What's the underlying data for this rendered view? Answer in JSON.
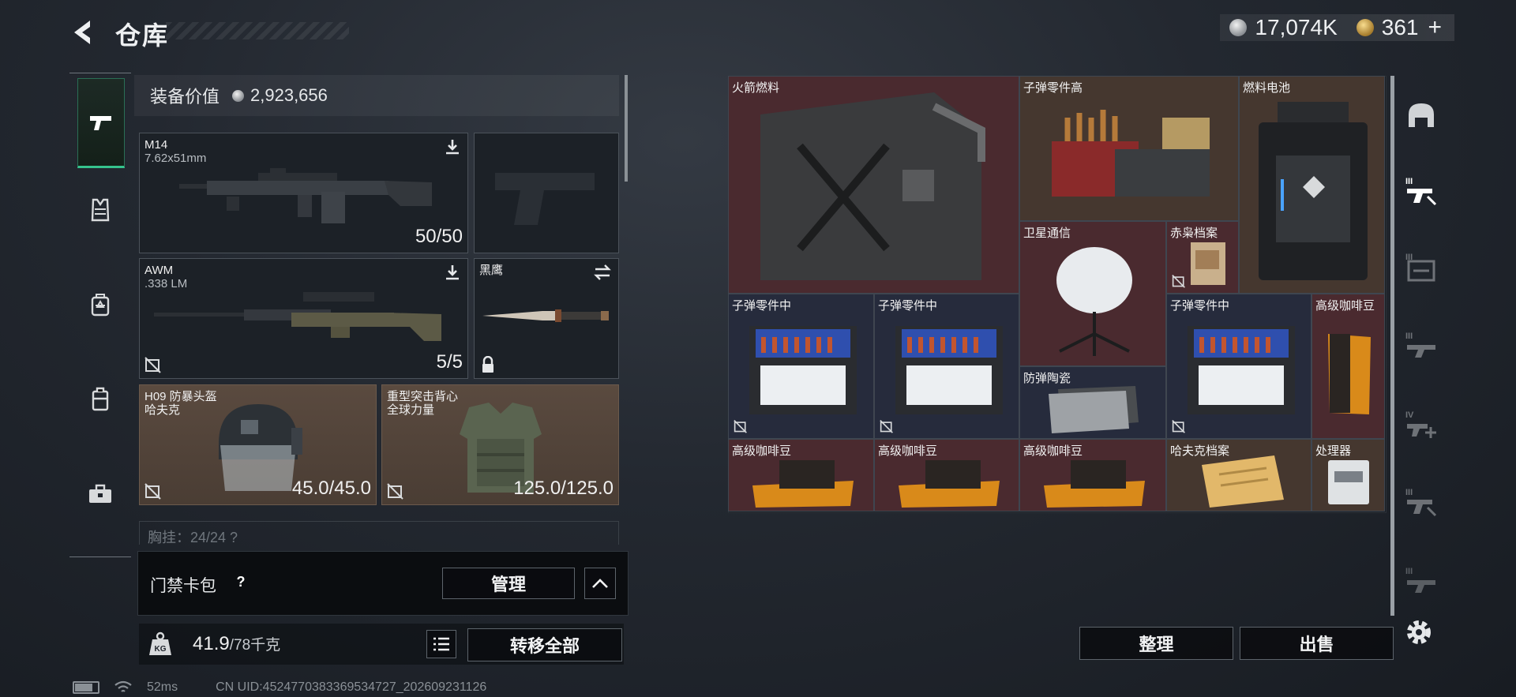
{
  "header": {
    "title": "仓库",
    "silver_amount": "17,074K",
    "gold_amount": "361",
    "gold_add": "+"
  },
  "tabs": [
    {
      "icon": "pistol-icon",
      "active": true
    },
    {
      "icon": "armor-vest-icon",
      "active": false
    },
    {
      "icon": "backpack-icon",
      "active": false
    },
    {
      "icon": "case-icon",
      "active": false
    },
    {
      "icon": "toolbox-icon",
      "active": false
    }
  ],
  "loadout": {
    "value_label": "装备价值",
    "value": "2,923,656",
    "slots": {
      "primary": {
        "name": "M14",
        "caliber": "7.62x51mm",
        "ammo": "50/50"
      },
      "sidearm": {
        "name": ""
      },
      "secondary": {
        "name": "AWM",
        "caliber": ".338 LM",
        "ammo": "5/5"
      },
      "melee": {
        "name": "黑鹰"
      },
      "helmet": {
        "name": "H09 防暴头盔\n哈夫克",
        "durability": "45.0/45.0"
      },
      "vest": {
        "name": "重型突击背心\n全球力量",
        "durability": "125.0/125.0"
      }
    },
    "peek_text": "胸挂：24/24  ?"
  },
  "card_pack": {
    "label": "门禁卡包",
    "help": "?",
    "manage_button": "管理",
    "expand_icon": "chevron-up-icon"
  },
  "weight": {
    "current": "41.9",
    "max": "/78千克",
    "transfer_all": "转移全部"
  },
  "stash": {
    "items": [
      {
        "name": "火箭燃料",
        "color": "red"
      },
      {
        "name": "子弹零件高",
        "color": "brown"
      },
      {
        "name": "燃料电池",
        "color": "brown"
      },
      {
        "name": "卫星通信",
        "color": "red"
      },
      {
        "name": "赤枭档案",
        "color": "red"
      },
      {
        "name": "子弹零件中",
        "color": "blue"
      },
      {
        "name": "子弹零件中",
        "color": "blue"
      },
      {
        "name": "防弹陶瓷",
        "color": "blue"
      },
      {
        "name": "子弹零件中",
        "color": "blue"
      },
      {
        "name": "高级咖啡豆",
        "color": "red"
      },
      {
        "name": "高级咖啡豆",
        "color": "red"
      },
      {
        "name": "高级咖啡豆",
        "color": "red"
      },
      {
        "name": "高级咖啡豆",
        "color": "red"
      },
      {
        "name": "哈夫克档案",
        "color": "brown"
      },
      {
        "name": "处理器",
        "color": "brown"
      }
    ],
    "sort_button": "整理",
    "sell_button": "出售"
  },
  "right_tabs": [
    {
      "icon": "helmet-slot-icon",
      "roman": ""
    },
    {
      "icon": "rifle-slot-icon",
      "roman": "III"
    },
    {
      "icon": "rifle-case-icon",
      "roman": "III"
    },
    {
      "icon": "rifle-slot-icon",
      "roman": "III"
    },
    {
      "icon": "rifle-add-icon",
      "roman": "IV"
    },
    {
      "icon": "rifle-slot-icon",
      "roman": "III"
    },
    {
      "icon": "rifle-slot-icon",
      "roman": "III"
    }
  ],
  "footer": {
    "ping": "52ms",
    "uid": "CN UID:4524770383369534727_202609231126"
  },
  "colors": {
    "accent_green": "#36c38d",
    "rarity_red": "#4a2a2f",
    "rarity_blue": "#262b3c",
    "rarity_gold": "#45372f"
  }
}
